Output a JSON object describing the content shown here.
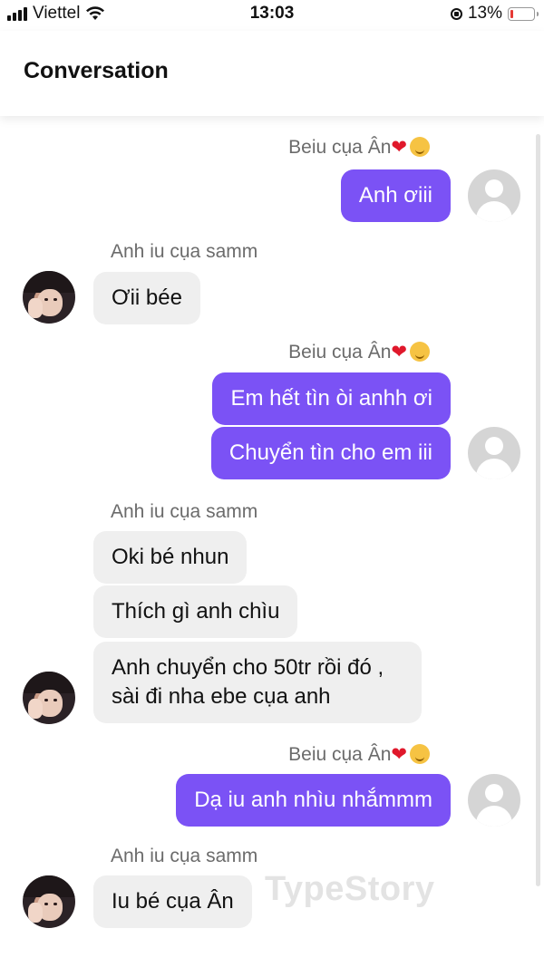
{
  "status_bar": {
    "carrier": "Viettel",
    "time": "13:03",
    "battery_percent": "13%",
    "battery_level": 0.13,
    "icons": [
      "signal-icon",
      "wifi-icon",
      "rotation-lock-icon",
      "battery-icon"
    ]
  },
  "header": {
    "title": "Conversation"
  },
  "messages": {
    "m1_sender": "Beiu cụa Ân",
    "m1_text": "Anh ơiii",
    "m2_sender": "Anh iu cụa samm",
    "m2_text": "Ơii bée",
    "m3_sender": "Beiu cụa Ân",
    "m3_text1": "Em hết tìn òi anhh ơi",
    "m3_text2": "Chuyển tìn cho em iii",
    "m4_sender": "Anh iu cụa samm",
    "m4_text1": "Oki bé nhun",
    "m4_text2": "Thích gì anh chìu",
    "m4_text3": "Anh chuyển cho 50tr rồi đó , sài đi nha ebe cụa anh",
    "m5_sender": "Beiu cụa Ân",
    "m5_text": "Dạ iu anh nhìu nhắmmm",
    "m6_sender": "Anh iu cụa samm",
    "m6_text": "Iu bé cụa Ân"
  },
  "watermark": "TypeStory",
  "colors": {
    "outgoing_bubble": "#7b52f5",
    "incoming_bubble": "#efefef",
    "sender_name": "#6b6b6b"
  }
}
